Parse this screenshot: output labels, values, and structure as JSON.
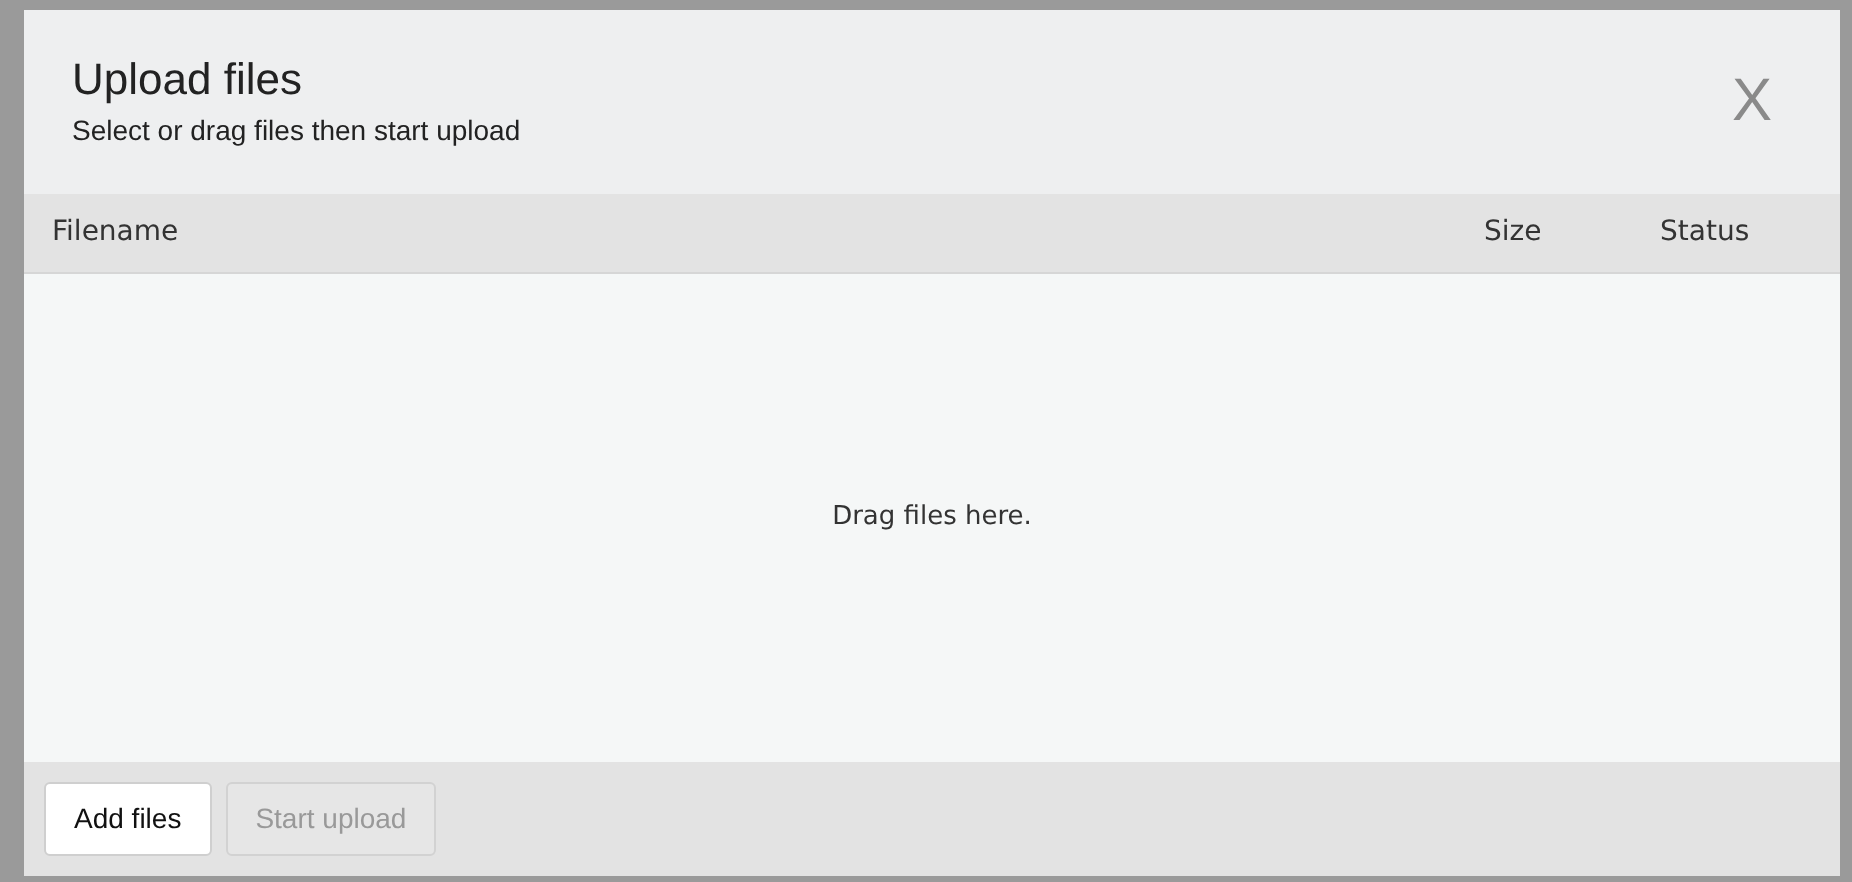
{
  "dialog": {
    "title": "Upload files",
    "subtitle": "Select or drag files then start upload",
    "close": "X"
  },
  "table": {
    "columns": [
      {
        "label": "Filename",
        "kind": "name"
      },
      {
        "label": "Size",
        "kind": "size"
      },
      {
        "label": "Status",
        "kind": "status"
      }
    ],
    "empty_text": "Drag files here."
  },
  "buttons": [
    {
      "label": "Add files",
      "disabled": false
    },
    {
      "label": "Start upload",
      "disabled": true
    }
  ]
}
